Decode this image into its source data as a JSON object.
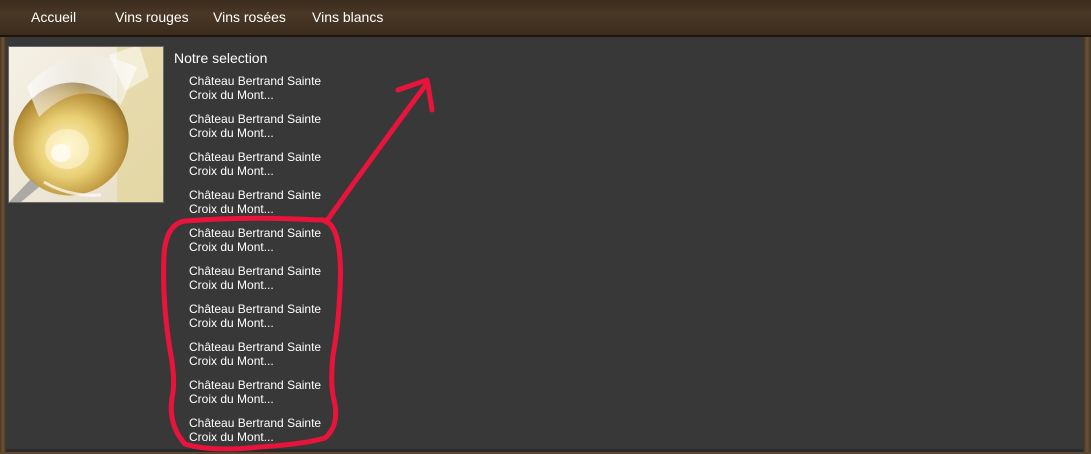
{
  "nav": {
    "items": [
      {
        "label": "Accueil"
      },
      {
        "label": "Vins rouges"
      },
      {
        "label": "Vins rosées"
      },
      {
        "label": "Vins blancs"
      }
    ]
  },
  "main": {
    "section_title": "Notre selection",
    "image_alt_icon": "white-wine-glass",
    "wines": [
      {
        "line1": "Château Bertrand Sainte",
        "line2": "Croix du Mont..."
      },
      {
        "line1": "Château Bertrand Sainte",
        "line2": "Croix du Mont..."
      },
      {
        "line1": "Château Bertrand Sainte",
        "line2": "Croix du Mont..."
      },
      {
        "line1": "Château Bertrand Sainte",
        "line2": "Croix du Mont..."
      },
      {
        "line1": "Château Bertrand Sainte",
        "line2": "Croix du Mont..."
      },
      {
        "line1": "Château Bertrand Sainte",
        "line2": "Croix du Mont..."
      },
      {
        "line1": "Château Bertrand Sainte",
        "line2": "Croix du Mont..."
      },
      {
        "line1": "Château Bertrand Sainte",
        "line2": "Croix du Mont..."
      },
      {
        "line1": "Château Bertrand Sainte",
        "line2": "Croix du Mont..."
      },
      {
        "line1": "Château Bertrand Sainte",
        "line2": "Croix du Mont..."
      }
    ]
  },
  "colors": {
    "annotation": "#e8143c",
    "panel": "#383838",
    "header": "#4a3826",
    "text": "#ffffff"
  }
}
